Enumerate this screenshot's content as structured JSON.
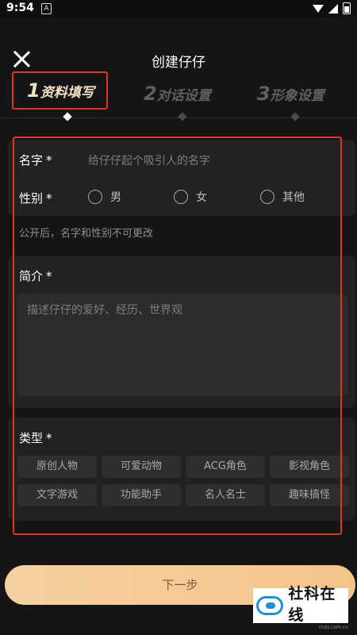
{
  "status_bar": {
    "time": "9:54",
    "notification": "A"
  },
  "header": {
    "title": "创建仔仔"
  },
  "steps": [
    {
      "num": "1",
      "label": "资料填写",
      "active": true
    },
    {
      "num": "2",
      "label": "对话设置",
      "active": false
    },
    {
      "num": "3",
      "label": "形象设置",
      "active": false
    }
  ],
  "form": {
    "name_label": "名字",
    "name_placeholder": "给仔仔起个吸引人的名字",
    "gender_label": "性别",
    "gender_options": [
      "男",
      "女",
      "其他"
    ],
    "hint": "公开后，名字和性别不可更改",
    "intro_label": "简介",
    "intro_placeholder": "描述仔仔的爱好、经历、世界观",
    "type_label": "类型",
    "required_mark": "*",
    "types": [
      "原创人物",
      "可爱动物",
      "ACG角色",
      "影视角色",
      "文字游戏",
      "功能助手",
      "名人名士",
      "趣味搞怪"
    ]
  },
  "next_button": "下一步",
  "watermark": {
    "main": "社科在线",
    "sub": "cnzs.com.cn"
  },
  "colors": {
    "accent": "#f3c488",
    "annotation": "#e0342a"
  }
}
